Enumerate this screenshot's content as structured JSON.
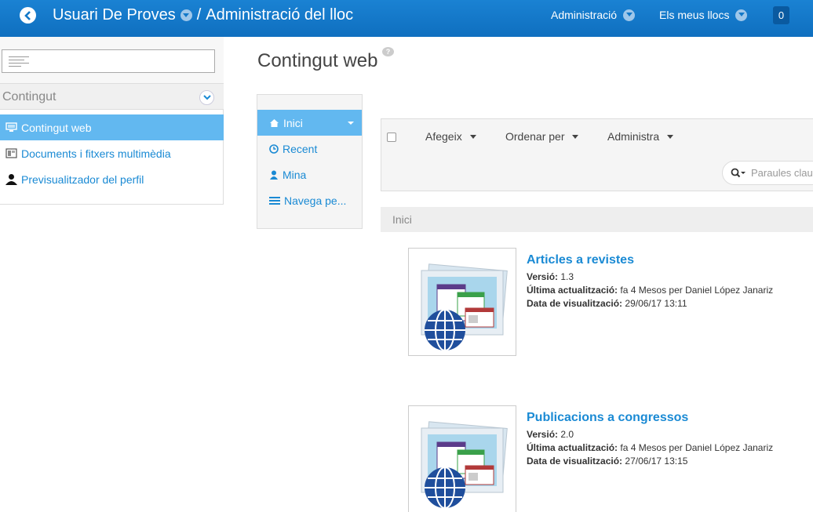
{
  "header": {
    "site_title": "Usuari De Proves",
    "separator": "/",
    "section_title": "Administració del lloc",
    "menus": [
      {
        "label": "Administració"
      },
      {
        "label": "Els meus llocs"
      }
    ],
    "notification_count": "0"
  },
  "sidebar": {
    "search_value": "",
    "section_label": "Contingut",
    "items": [
      {
        "label": "Contingut web",
        "icon": "monitor-icon",
        "active": true
      },
      {
        "label": "Documents i fitxers multimèdia",
        "icon": "documents-icon",
        "active": false
      },
      {
        "label": "Previsualitzador del perfil",
        "icon": "user-icon",
        "active": false
      }
    ]
  },
  "main": {
    "page_title": "Contingut web",
    "help_glyph": "?",
    "nav": [
      {
        "label": "Inici",
        "icon": "home-icon",
        "active": true
      },
      {
        "label": "Recent",
        "icon": "clock-icon",
        "active": false
      },
      {
        "label": "Mina",
        "icon": "user-icon",
        "active": false
      },
      {
        "label": "Navega pe...",
        "icon": "list-icon",
        "active": false
      }
    ],
    "toolbar": {
      "add_label": "Afegeix",
      "order_label": "Ordenar per",
      "manage_label": "Administra",
      "search_placeholder": "Paraules clau"
    },
    "breadcrumb": "Inici",
    "entries": [
      {
        "title": "Articles a revistes",
        "version_label": "Versió:",
        "version": "1.3",
        "updated_label": "Última actualització:",
        "updated": "fa 4 Mesos per Daniel López Janariz",
        "display_label": "Data de visualització:",
        "display_date": "29/06/17 13:11"
      },
      {
        "title": "Publicacions a congressos",
        "version_label": "Versió:",
        "version": "2.0",
        "updated_label": "Última actualització:",
        "updated": "fa 4 Mesos per Daniel López Janariz",
        "display_label": "Data de visualització:",
        "display_date": "27/06/17 13:15"
      }
    ]
  },
  "colors": {
    "header_blue": "#1278c8",
    "active_blue": "#62b8f0",
    "link_blue": "#1a8ad4"
  }
}
